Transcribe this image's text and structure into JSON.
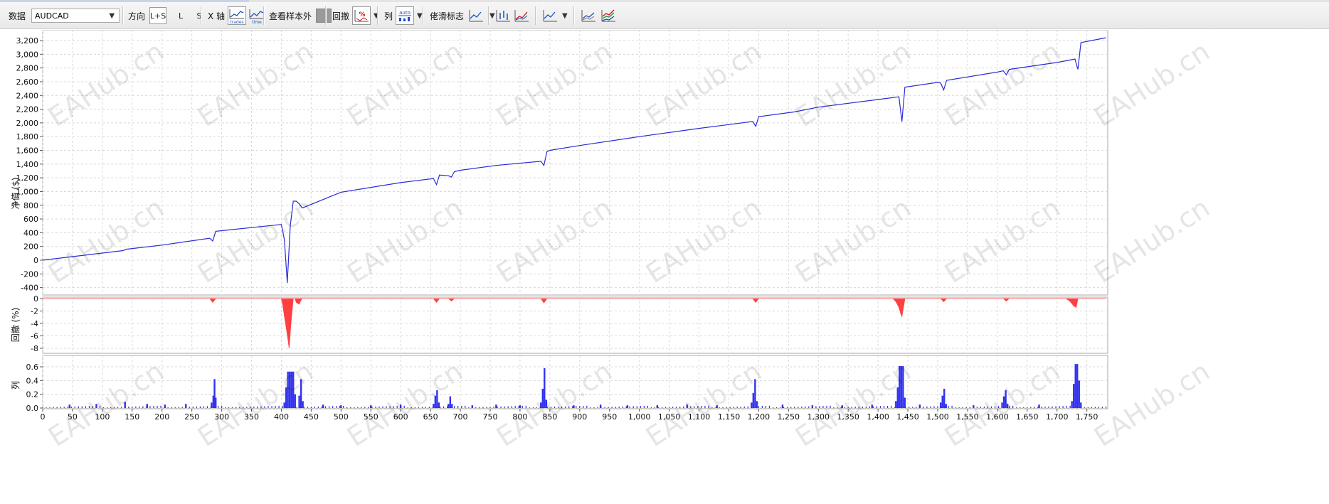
{
  "toolbar": {
    "data_label": "数据",
    "symbol": "AUDCAD",
    "direction_label": "方向",
    "dir_ls": "L+S",
    "dir_l": "L",
    "dir_s": "S",
    "xaxis_label": "X 轴",
    "xaxis_trades": "trades",
    "xaxis_time": "time",
    "out_of_sample_label": "查看样本外",
    "drawdown_label": "回撤",
    "drawdown_icon_text": "%",
    "column_label": "列",
    "column_auto": "auto",
    "markers_label": "佬滑标志"
  },
  "watermark": "EAHub.cn",
  "colors": {
    "equity_line": "#2b2bd6",
    "drawdown_fill": "#ff4040",
    "column_fill": "#3232f0",
    "grid": "#d8d8d8"
  },
  "chart_data": [
    {
      "type": "line",
      "ylabel": "净值 ($)",
      "ylim": [
        -500,
        3350
      ],
      "yticks": [
        "3,200",
        "3,000",
        "2,800",
        "2,600",
        "2,400",
        "2,200",
        "2,000",
        "1,800",
        "1,600",
        "1,400",
        "1,200",
        "1,000",
        "800",
        "600",
        "400",
        "200",
        "0",
        "-200",
        "-400"
      ],
      "xlim": [
        0,
        1785
      ],
      "grid": true,
      "series": [
        {
          "x": [
            0,
            135,
            140,
            200,
            280,
            285,
            290,
            300,
            400,
            405,
            410,
            415,
            420,
            425,
            430,
            435,
            500,
            600,
            655,
            660,
            665,
            680,
            685,
            690,
            700,
            760,
            835,
            840,
            845,
            850,
            900,
            1000,
            1100,
            1190,
            1195,
            1200,
            1260,
            1300,
            1400,
            1435,
            1440,
            1445,
            1500,
            1505,
            1510,
            1515,
            1600,
            1610,
            1615,
            1620,
            1700,
            1730,
            1735,
            1740,
            1782
          ],
          "y": [
            0,
            140,
            160,
            220,
            320,
            280,
            420,
            430,
            520,
            300,
            -330,
            500,
            860,
            860,
            820,
            760,
            990,
            1130,
            1190,
            1100,
            1240,
            1230,
            1210,
            1290,
            1310,
            1380,
            1440,
            1380,
            1580,
            1600,
            1670,
            1800,
            1920,
            2020,
            1950,
            2090,
            2160,
            2230,
            2340,
            2380,
            2020,
            2520,
            2590,
            2580,
            2480,
            2620,
            2740,
            2760,
            2700,
            2780,
            2880,
            2930,
            2780,
            3170,
            3240
          ]
        }
      ]
    },
    {
      "type": "area",
      "ylabel": "回撤 (%)",
      "ylim": [
        -8.6,
        0
      ],
      "yticks": [
        "0",
        "-2",
        "-4",
        "-6",
        "-8"
      ],
      "xlim": [
        0,
        1785
      ],
      "grid": true,
      "series": [
        {
          "x": [
            0,
            280,
            285,
            290,
            400,
            402,
            405,
            410,
            413,
            416,
            420,
            423,
            425,
            430,
            432,
            435,
            655,
            660,
            665,
            680,
            685,
            690,
            835,
            840,
            845,
            1190,
            1195,
            1200,
            1425,
            1430,
            1435,
            1438,
            1440,
            1442,
            1445,
            1505,
            1510,
            1515,
            1610,
            1615,
            1620,
            1715,
            1720,
            1725,
            1728,
            1732,
            1735,
            1782
          ],
          "y": [
            0,
            0,
            -0.6,
            0,
            0,
            -0.8,
            -2.8,
            -5.8,
            -8.0,
            -4.0,
            0,
            0,
            -0.6,
            -0.9,
            -0.4,
            0,
            0,
            -0.6,
            0,
            0,
            -0.4,
            0,
            0,
            -0.7,
            0,
            0,
            -0.6,
            0,
            0,
            -0.5,
            -1.4,
            -2.4,
            -2.9,
            -1.8,
            0,
            0,
            -0.5,
            0,
            0,
            -0.4,
            0,
            0,
            -0.3,
            -0.8,
            -1.2,
            -1.4,
            0,
            0
          ]
        }
      ]
    },
    {
      "type": "bar",
      "ylabel": "列",
      "ylim": [
        0,
        0.66
      ],
      "yticks": [
        "0.6",
        "0.4",
        "0.2",
        "0.0"
      ],
      "xlim": [
        0,
        1785
      ],
      "xticks": [
        "0",
        "50",
        "100",
        "150",
        "200",
        "250",
        "300",
        "350",
        "400",
        "450",
        "500",
        "550",
        "600",
        "650",
        "700",
        "750",
        "800",
        "850",
        "900",
        "950",
        "1,000",
        "1,050",
        "1,100",
        "1,150",
        "1,200",
        "1,250",
        "1,300",
        "1,350",
        "1,400",
        "1,450",
        "1,500",
        "1,550",
        "1,600",
        "1,650",
        "1,700",
        "1,750"
      ],
      "grid": true,
      "bars": [
        {
          "x": 45,
          "v": 0.05
        },
        {
          "x": 90,
          "v": 0.06
        },
        {
          "x": 138,
          "v": 0.09
        },
        {
          "x": 175,
          "v": 0.06
        },
        {
          "x": 205,
          "v": 0.05
        },
        {
          "x": 240,
          "v": 0.06
        },
        {
          "x": 283,
          "v": 0.08
        },
        {
          "x": 286,
          "v": 0.18
        },
        {
          "x": 288,
          "v": 0.42
        },
        {
          "x": 290,
          "v": 0.15
        },
        {
          "x": 405,
          "v": 0.08
        },
        {
          "x": 408,
          "v": 0.3
        },
        {
          "x": 411,
          "v": 0.53
        },
        {
          "x": 414,
          "v": 0.53
        },
        {
          "x": 417,
          "v": 0.53
        },
        {
          "x": 420,
          "v": 0.53
        },
        {
          "x": 423,
          "v": 0.2
        },
        {
          "x": 430,
          "v": 0.18
        },
        {
          "x": 433,
          "v": 0.42
        },
        {
          "x": 436,
          "v": 0.1
        },
        {
          "x": 470,
          "v": 0.05
        },
        {
          "x": 500,
          "v": 0.04
        },
        {
          "x": 550,
          "v": 0.04
        },
        {
          "x": 600,
          "v": 0.05
        },
        {
          "x": 655,
          "v": 0.06
        },
        {
          "x": 658,
          "v": 0.18
        },
        {
          "x": 661,
          "v": 0.26
        },
        {
          "x": 664,
          "v": 0.08
        },
        {
          "x": 680,
          "v": 0.06
        },
        {
          "x": 683,
          "v": 0.17
        },
        {
          "x": 686,
          "v": 0.06
        },
        {
          "x": 720,
          "v": 0.04
        },
        {
          "x": 760,
          "v": 0.05
        },
        {
          "x": 800,
          "v": 0.04
        },
        {
          "x": 835,
          "v": 0.08
        },
        {
          "x": 838,
          "v": 0.28
        },
        {
          "x": 841,
          "v": 0.58
        },
        {
          "x": 844,
          "v": 0.12
        },
        {
          "x": 890,
          "v": 0.04
        },
        {
          "x": 935,
          "v": 0.05
        },
        {
          "x": 980,
          "v": 0.04
        },
        {
          "x": 1030,
          "v": 0.04
        },
        {
          "x": 1080,
          "v": 0.05
        },
        {
          "x": 1130,
          "v": 0.04
        },
        {
          "x": 1188,
          "v": 0.08
        },
        {
          "x": 1191,
          "v": 0.22
        },
        {
          "x": 1194,
          "v": 0.42
        },
        {
          "x": 1197,
          "v": 0.1
        },
        {
          "x": 1240,
          "v": 0.05
        },
        {
          "x": 1290,
          "v": 0.04
        },
        {
          "x": 1340,
          "v": 0.04
        },
        {
          "x": 1390,
          "v": 0.05
        },
        {
          "x": 1430,
          "v": 0.1
        },
        {
          "x": 1433,
          "v": 0.3
        },
        {
          "x": 1436,
          "v": 0.61
        },
        {
          "x": 1439,
          "v": 0.61
        },
        {
          "x": 1442,
          "v": 0.61
        },
        {
          "x": 1445,
          "v": 0.15
        },
        {
          "x": 1470,
          "v": 0.05
        },
        {
          "x": 1505,
          "v": 0.08
        },
        {
          "x": 1508,
          "v": 0.18
        },
        {
          "x": 1511,
          "v": 0.28
        },
        {
          "x": 1514,
          "v": 0.06
        },
        {
          "x": 1560,
          "v": 0.04
        },
        {
          "x": 1608,
          "v": 0.08
        },
        {
          "x": 1611,
          "v": 0.17
        },
        {
          "x": 1614,
          "v": 0.26
        },
        {
          "x": 1617,
          "v": 0.06
        },
        {
          "x": 1670,
          "v": 0.05
        },
        {
          "x": 1725,
          "v": 0.1
        },
        {
          "x": 1728,
          "v": 0.35
        },
        {
          "x": 1731,
          "v": 0.64
        },
        {
          "x": 1734,
          "v": 0.64
        },
        {
          "x": 1737,
          "v": 0.4
        },
        {
          "x": 1740,
          "v": 0.08
        }
      ]
    }
  ]
}
